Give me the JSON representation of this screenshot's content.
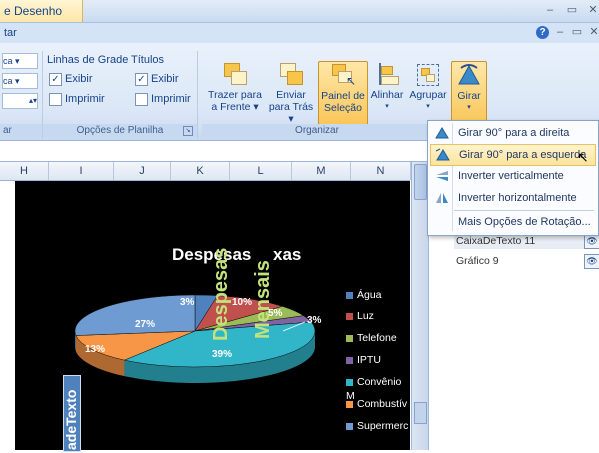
{
  "window": {
    "title": "e Desenho",
    "tab_label": "tar",
    "min": "–",
    "restore": "▭",
    "close": "✕",
    "help": "?"
  },
  "ribbon": {
    "left_partial": {
      "row1": "ca ▾",
      "row2": "ca ▾",
      "row3": "▴▾",
      "footer": "ar"
    },
    "grid_group": {
      "title_linhas": "Linhas de Grade",
      "title_titulos": "Títulos",
      "exibir1": "Exibir",
      "exibir2": "Exibir",
      "imprimir1": "Imprimir",
      "imprimir2": "Imprimir",
      "label": "Opções de Planilha"
    },
    "arrange_group": {
      "label": "Organizar",
      "buttons": [
        {
          "l1": "Trazer para",
          "l2": "a Frente ▾"
        },
        {
          "l1": "Enviar",
          "l2": "para Trás ▾"
        },
        {
          "l1": "Painel de",
          "l2": "Seleção"
        },
        {
          "l1": "Alinhar",
          "l2": "▾"
        },
        {
          "l1": "Agrupar",
          "l2": "▾"
        },
        {
          "l1": "Girar",
          "l2": "▾"
        }
      ]
    }
  },
  "columns": [
    "H",
    "I",
    "J",
    "K",
    "L",
    "M",
    "N"
  ],
  "menu": {
    "items": [
      {
        "label": "Girar 90° para a direita",
        "icon": "rotate-right-icon"
      },
      {
        "label": "Girar 90° para a esquerda",
        "icon": "rotate-left-icon"
      },
      {
        "label": "Inverter verticalmente",
        "icon": "flip-vertical-icon"
      },
      {
        "label": "Inverter horizontalmente",
        "icon": "flip-horizontal-icon"
      },
      {
        "label": "Mais Opções de Rotação...",
        "icon": ""
      }
    ]
  },
  "pane": {
    "items": [
      "CaixaDeTexto 11",
      "Gráfico 9"
    ]
  },
  "chart": {
    "title_part1": "Despesas",
    "title_part2": "xas",
    "vertical_word1": "Despesas",
    "vertical_word2": "Mensais",
    "vertical_textbox": "adeTexto",
    "labels": {
      "p1": "3%",
      "p2": "10%",
      "p3": "5%",
      "p4": "3%",
      "p5": "27%",
      "p6": "13%",
      "p7": "39%"
    }
  },
  "chart_data": {
    "type": "pie",
    "title": "Despesas Fixas",
    "categories": [
      "Água",
      "Luz",
      "Telefone",
      "IPTU",
      "Convênio M",
      "Combustív",
      "Supermerc"
    ],
    "values": [
      3,
      10,
      5,
      3,
      39,
      13,
      27
    ],
    "legend_position": "right",
    "colors": [
      "#4f81bd",
      "#c0504d",
      "#9bbb59",
      "#8064a2",
      "#31b6c9",
      "#f79646",
      "#6e9bd1"
    ]
  }
}
